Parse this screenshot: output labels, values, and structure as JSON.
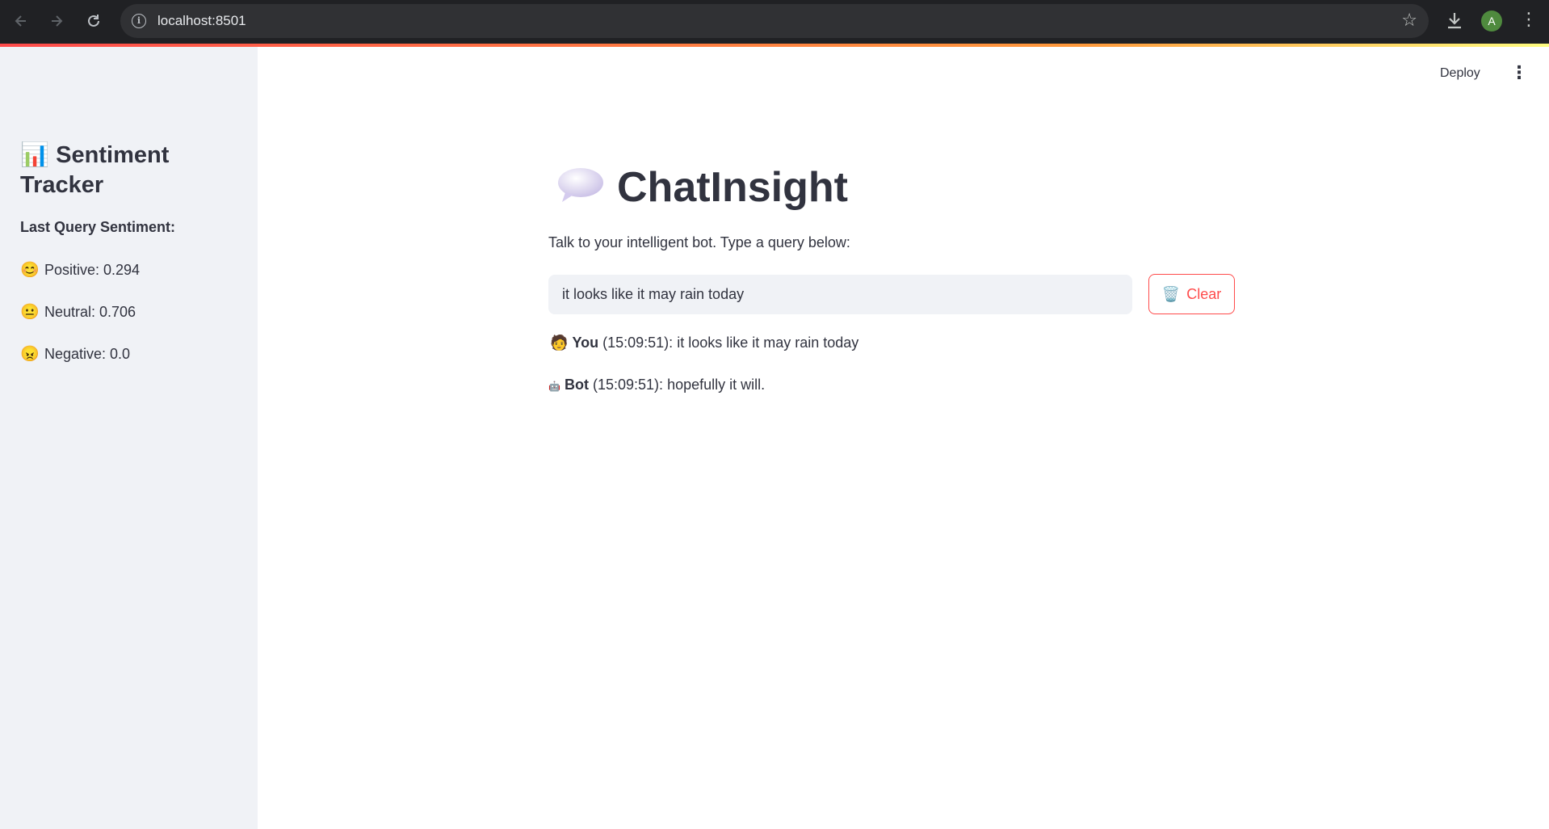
{
  "browser": {
    "url": "localhost:8501",
    "avatar_initial": "A",
    "icons": {
      "back": "arrow-left-icon",
      "forward": "arrow-right-icon",
      "reload": "reload-icon",
      "site_info": "info-icon",
      "bookmark": "star-icon",
      "download": "download-icon",
      "menu": "vertical-dots-icon"
    }
  },
  "header": {
    "deploy_label": "Deploy",
    "menu_icon": "vertical-dots-icon"
  },
  "sidebar": {
    "title_emoji": "📊",
    "title": "Sentiment Tracker",
    "subtitle": "Last Query Sentiment:",
    "scores": [
      {
        "emoji": "😊",
        "text": "Positive: 0.294"
      },
      {
        "emoji": "😐",
        "text": "Neutral: 0.706"
      },
      {
        "emoji": "😠",
        "text": "Negative: 0.0"
      }
    ]
  },
  "main": {
    "title": "ChatInsight",
    "title_icon": "speech-bubble-icon",
    "caption": "Talk to your intelligent bot. Type a query below:",
    "query_value": "it looks like it may rain today",
    "clear_emoji": "🗑️",
    "clear_label": "Clear",
    "messages": [
      {
        "emoji": "🧑",
        "sender": "You",
        "time": "(15:09:51):",
        "text": "it looks like it may rain today"
      },
      {
        "emoji": "🤖",
        "sender": "Bot",
        "time": "(15:09:51):",
        "text": "hopefully it will."
      }
    ]
  },
  "colors": {
    "accent": "#ff4b4b",
    "sidebar_bg": "#f0f2f6",
    "text": "#31333f",
    "chrome_bg": "#202124"
  }
}
